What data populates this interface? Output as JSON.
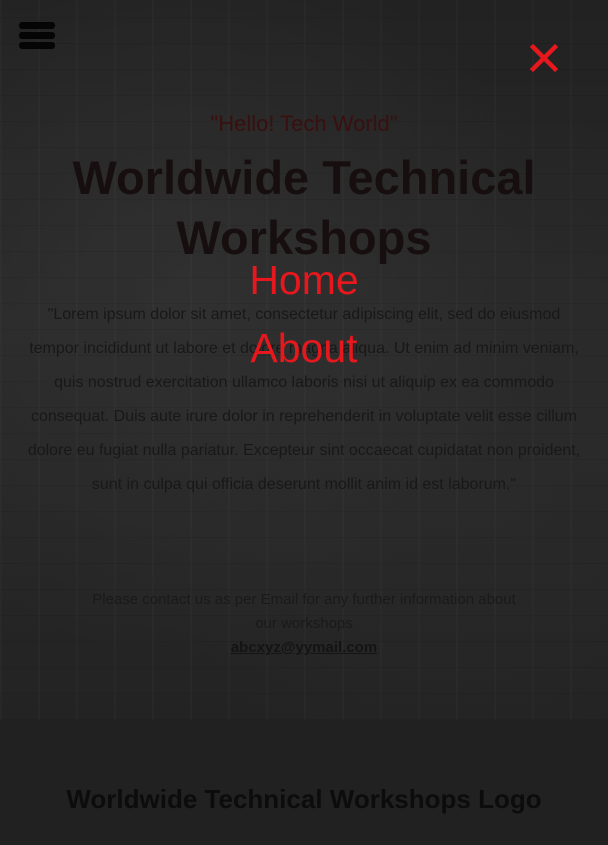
{
  "hero": {
    "tagline": "\"Hello! Tech World\"",
    "title": "Worldwide Technical Workshops",
    "paragraph": "\"Lorem ipsum dolor sit amet, consectetur adipiscing elit, sed do eiusmod tempor incididunt ut labore et dolore magna aliqua. Ut enim ad minim veniam, quis nostrud exercitation ullamco laboris nisi ut aliquip ex ea commodo consequat. Duis aute irure dolor in reprehenderit in voluptate velit esse cillum dolore eu fugiat nulla pariatur. Excepteur sint occaecat cupidatat non proident, sunt in culpa qui officia deserunt mollit anim id est laborum.\""
  },
  "contact": {
    "text": "Please contact us as per Email for any further information about our workshops",
    "email": "abcxyz@yymail.com"
  },
  "footer": {
    "title": "Worldwide Technical Workshops Logo"
  },
  "menu": {
    "items": [
      {
        "label": "Home"
      },
      {
        "label": "About"
      }
    ]
  },
  "icons": {
    "menu": "hamburger-menu-icon",
    "close": "close-icon"
  },
  "colors": {
    "accent": "#e6181d",
    "background": "#2b2b2b"
  }
}
